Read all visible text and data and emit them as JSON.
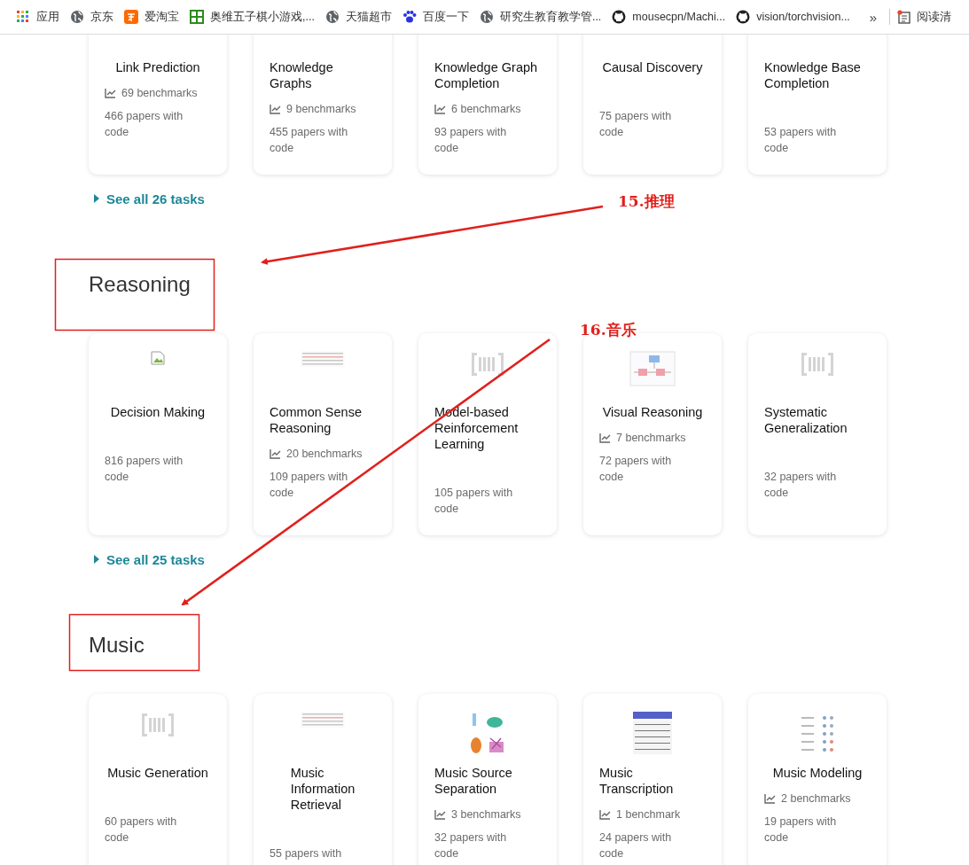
{
  "bookmarks_bar": {
    "items": [
      {
        "kind": "apps",
        "label": "应用"
      },
      {
        "kind": "globe",
        "label": "京东"
      },
      {
        "kind": "taobao",
        "label": "爱淘宝"
      },
      {
        "kind": "game",
        "label": "奥维五子棋小游戏,..."
      },
      {
        "kind": "globe",
        "label": "天猫超市"
      },
      {
        "kind": "paw",
        "label": "百度一下"
      },
      {
        "kind": "globe",
        "label": "研究生教育教学管..."
      },
      {
        "kind": "github",
        "label": "mousecpn/Machi..."
      },
      {
        "kind": "github",
        "label": "vision/torchvision..."
      }
    ],
    "overflow": "»",
    "reading_list": "阅读清"
  },
  "sections": [
    {
      "cards": [
        {
          "title": "Link Prediction",
          "benchmarks": "69 benchmarks",
          "papers": "466 papers with code"
        },
        {
          "title": "Knowledge Graphs",
          "benchmarks": "9 benchmarks",
          "papers": "455 papers with code"
        },
        {
          "title": "Knowledge Graph Completion",
          "benchmarks": "6 benchmarks",
          "papers": "93 papers with code"
        },
        {
          "title": "Causal Discovery",
          "papers": "75 papers with code"
        },
        {
          "title": "Knowledge Base Completion",
          "papers": "53 papers with code"
        }
      ],
      "see_all": "See all 26 tasks"
    },
    {
      "heading": "Reasoning",
      "cards": [
        {
          "kind": "broken-image",
          "title": "Decision Making",
          "papers": "816 papers with code"
        },
        {
          "kind": "table",
          "title": "Common Sense Reasoning",
          "benchmarks": "20 benchmarks",
          "papers": "109 papers with code"
        },
        {
          "kind": "logo",
          "title": "Model-based Reinforcement Learning",
          "papers": "105 papers with code"
        },
        {
          "kind": "diagram",
          "title": "Visual Reasoning",
          "benchmarks": "7 benchmarks",
          "papers": "72 papers with code"
        },
        {
          "kind": "logo",
          "title": "Systematic Generalization",
          "papers": "32 papers with code"
        }
      ],
      "see_all": "See all 25 tasks"
    },
    {
      "heading": "Music",
      "cards": [
        {
          "kind": "logo",
          "title": "Music Generation",
          "papers": "60 papers with code"
        },
        {
          "kind": "table",
          "title": "Music\nInformation\nRetrieval",
          "papers": "55 papers with"
        },
        {
          "kind": "instruments",
          "title": "Music Source Separation",
          "benchmarks": "3 benchmarks",
          "papers": "32 papers with code"
        },
        {
          "kind": "score",
          "title": "Music Transcription",
          "benchmarks": "1 benchmark",
          "papers": "24 papers with code"
        },
        {
          "kind": "dot-chart",
          "title": "Music Modeling",
          "benchmarks": "2 benchmarks",
          "papers": "19 papers with code"
        }
      ]
    }
  ],
  "annotations": [
    {
      "kind": "arrow-label",
      "label": "15.推理"
    },
    {
      "kind": "arrow-label",
      "label": "16.音乐"
    }
  ]
}
